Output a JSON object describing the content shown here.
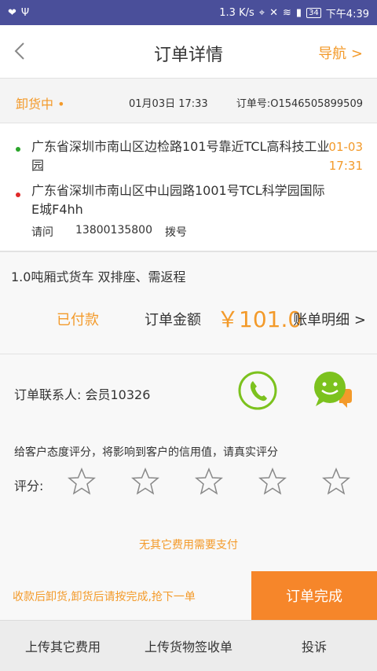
{
  "status_bar": {
    "speed": "1.3 K/s",
    "battery": "34",
    "time": "下午4:39"
  },
  "header": {
    "title": "订单详情",
    "nav_label": "导航 >"
  },
  "order": {
    "status": "卸货中 •",
    "datetime": "01月03日 17:33",
    "order_no": "订单号:O1546505899509"
  },
  "addresses": {
    "from": "广东省深圳市南山区边检路101号靠近TCL高科技工业园",
    "to": "广东省深圳市南山区中山园路1001号TCL科学园国际E城F4hh",
    "time_date": "01-03",
    "time_clock": "17:31",
    "ask_label": "请问",
    "phone": "13800135800",
    "dial_label": "拨号",
    "from_dot_color": "#2aa52a",
    "to_dot_color": "#e02a2a"
  },
  "vehicle": {
    "desc": "1.0吨厢式货车  双排座、需返程",
    "paid_label": "已付款",
    "amount_label": "订单金额",
    "amount": "￥101.0",
    "bill_label": "账单明细 >"
  },
  "contact": {
    "label": "订单联系人:  会员10326",
    "rate_hint": "给客户态度评分，将影响到客户的信用值，请真实评分",
    "rate_label": "评分:",
    "no_fee": "无其它费用需要支付"
  },
  "action": {
    "tip": "收款后卸货,卸货后请按完成,抢下一单",
    "done_label": "订单完成"
  },
  "footer": {
    "upload_fees": "上传其它费用",
    "upload_receipt": "上传货物签收单",
    "complain": "投诉"
  },
  "colors": {
    "accent": "#f39a2a",
    "status_bar_bg": "#4a4f9a",
    "done_bg": "#f6862a",
    "green": "#7cc21e"
  }
}
